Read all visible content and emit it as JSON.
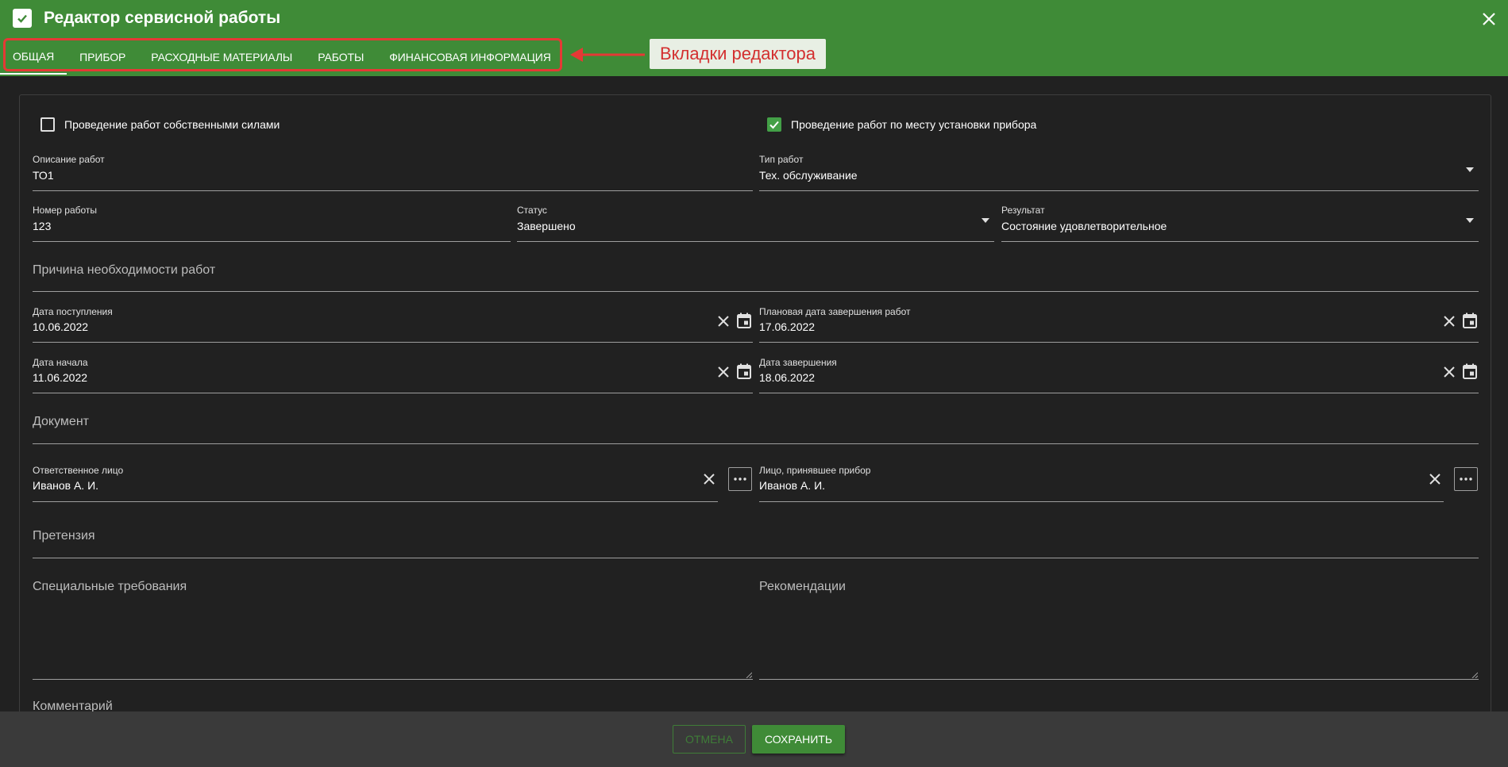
{
  "window": {
    "title": "Редактор сервисной работы"
  },
  "tabs": [
    {
      "label": "ОБЩАЯ",
      "active": true
    },
    {
      "label": "ПРИБОР"
    },
    {
      "label": "РАСХОДНЫЕ МАТЕРИАЛЫ"
    },
    {
      "label": "РАБОТЫ"
    },
    {
      "label": "ФИНАНСОВАЯ ИНФОРМАЦИЯ"
    }
  ],
  "annotation": {
    "label": "Вкладки редактора",
    "color": "#e53935"
  },
  "form": {
    "own_forces": {
      "label": "Проведение работ собственными силами",
      "checked": false
    },
    "onsite": {
      "label": "Проведение работ по месту установки прибора",
      "checked": true
    },
    "description": {
      "label": "Описание работ",
      "value": "ТО1"
    },
    "work_type": {
      "label": "Тип работ",
      "value": "Тех. обслуживание"
    },
    "work_number": {
      "label": "Номер работы",
      "value": "123"
    },
    "status": {
      "label": "Статус",
      "value": "Завершено"
    },
    "result": {
      "label": "Результат",
      "value": "Состояние удовлетворительное"
    },
    "reason": {
      "placeholder": "Причина необходимости работ"
    },
    "received_date": {
      "label": "Дата поступления",
      "value": "10.06.2022"
    },
    "planned_end_date": {
      "label": "Плановая дата завершения работ",
      "value": "17.06.2022"
    },
    "start_date": {
      "label": "Дата начала",
      "value": "11.06.2022"
    },
    "end_date": {
      "label": "Дата завершения",
      "value": "18.06.2022"
    },
    "document": {
      "placeholder": "Документ"
    },
    "responsible": {
      "label": "Ответственное лицо",
      "value": "Иванов А. И."
    },
    "receiver": {
      "label": "Лицо, принявшее прибор",
      "value": "Иванов А. И."
    },
    "claim": {
      "placeholder": "Претензия"
    },
    "special_requirements": {
      "placeholder": "Специальные требования"
    },
    "recommendations": {
      "placeholder": "Рекомендации"
    },
    "comment": {
      "placeholder": "Комментарий"
    }
  },
  "footer": {
    "cancel_label": "ОТМЕНА",
    "save_label": "СОХРАНИТЬ"
  },
  "colors": {
    "header": "#3f8b37",
    "background": "#212121",
    "checkbox_checked": "#43a047"
  }
}
